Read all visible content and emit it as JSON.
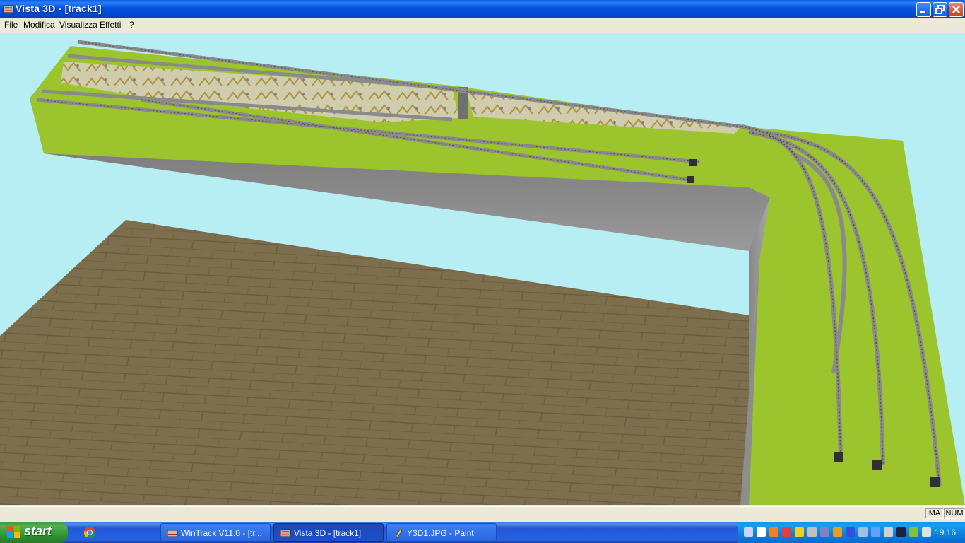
{
  "window": {
    "title": "Vista 3D - [track1]",
    "minimize_icon": "minimize-icon",
    "restore_icon": "restore-icon",
    "close_icon": "close-icon"
  },
  "menu": {
    "items": [
      "File",
      "Modifica",
      "Visualizza",
      "Effetti",
      "?"
    ]
  },
  "status": {
    "caps": "MA",
    "num": "NUM"
  },
  "taskbar": {
    "start_label": "start",
    "tasks": [
      {
        "label": "WinTrack  V11.0 - [tr...",
        "icon": "wintrack-icon",
        "active": false
      },
      {
        "label": "Vista 3D - [track1]",
        "icon": "vista3d-icon",
        "active": true
      },
      {
        "label": "Y3D1.JPG - Paint",
        "icon": "paint-icon",
        "active": false
      }
    ],
    "quicklaunch": [
      "chrome-icon"
    ],
    "clock": "19.16"
  },
  "colors": {
    "sky": "#b6eef3",
    "grass": "#9cc42c",
    "wall": "#8a8a8a",
    "brick": "#7d6f4e"
  }
}
